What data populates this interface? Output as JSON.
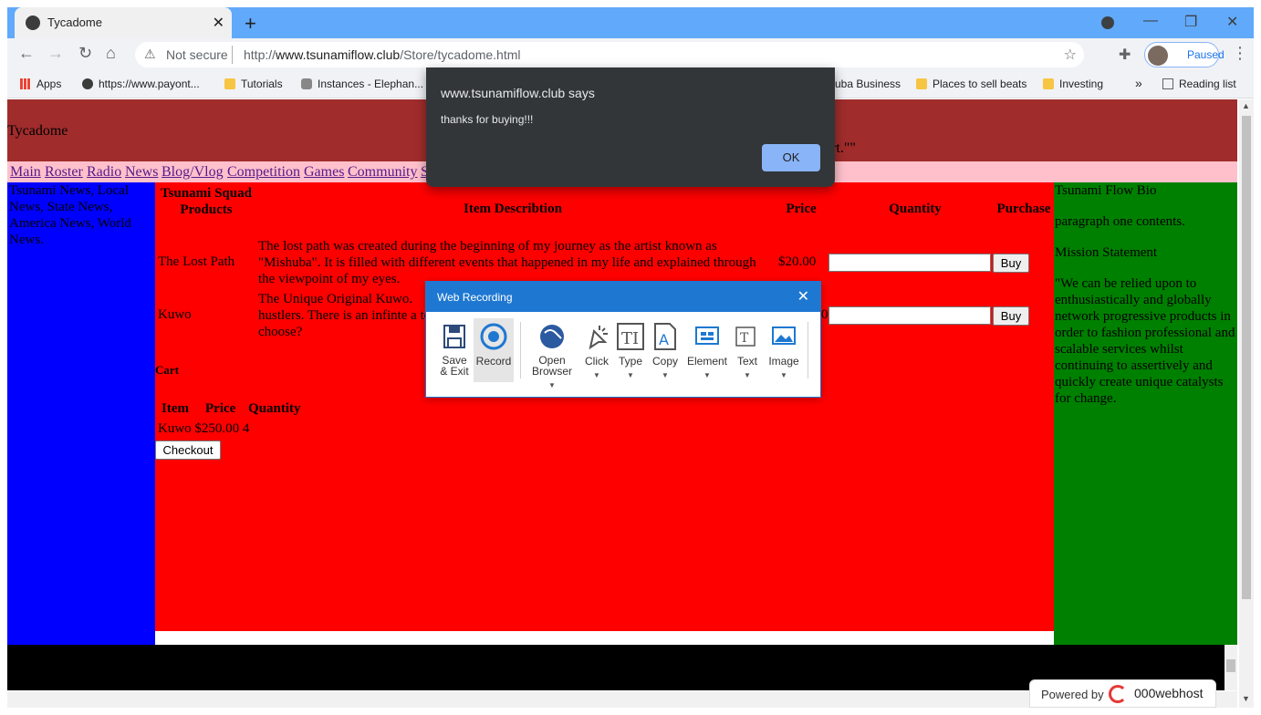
{
  "browser": {
    "tab_title": "Tycadome",
    "tab_close": "✕",
    "new_tab": "+",
    "security": "Not secure",
    "url_prefix": "http://",
    "url_domain": "www.tsunamiflow.club",
    "url_path": "/Store/tycadome.html",
    "profile_label": "Paused",
    "bookmarks": [
      {
        "label": "Apps",
        "icon": "apps-grid-icon"
      },
      {
        "label": "https://www.payont...",
        "icon": "globe-icon"
      },
      {
        "label": "Tutorials",
        "icon": "folder-icon"
      },
      {
        "label": "Instances - Elephan...",
        "icon": "elephant-icon"
      },
      {
        "label": "uba Business",
        "icon": "none"
      },
      {
        "label": "Places to sell beats",
        "icon": "folder-icon"
      },
      {
        "label": "Investing",
        "icon": "folder-icon"
      },
      {
        "label": "»",
        "icon": "none"
      },
      {
        "label": "Reading list",
        "icon": "reading-list-icon"
      }
    ]
  },
  "page": {
    "site_title": "Tycadome",
    "header_tail": "art.\"\"",
    "nav": [
      "Main",
      "Roster",
      "Radio",
      "News",
      "Blog/Vlog",
      "Competition",
      "Games",
      "Community",
      "S"
    ],
    "left_text": "Tsunami News, Local News, State News, America News, World News.",
    "table": {
      "headers": [
        "Tsunami Squad Products",
        "Item Describtion",
        "Price",
        "Quantity",
        "Purchase"
      ],
      "rows": [
        {
          "name": "The Lost Path",
          "desc": "The lost path was created during the beginning of my journey as the artist known as \"Mishuba\". It is filled with different events that happened in my life and explained through the viewpoint of my eyes.",
          "price": "$20.00",
          "buy": "Buy"
        },
        {
          "name": "Kuwo",
          "desc": "The Unique Original Kuwo. hustlers. There is an infinte a to choose?",
          "price": "0",
          "buy": "Buy"
        }
      ]
    },
    "cart": {
      "title": "Cart",
      "headers": [
        "Item",
        "Price",
        "Quantity"
      ],
      "row": "Kuwo $250.00 4",
      "checkout": "Checkout"
    },
    "right": {
      "bio_title": "Tsunami Flow Bio",
      "paragraph": "paragraph one contents.",
      "mission_title": "Mission Statement",
      "mission_text": "\"We can be relied upon to enthusiastically and globally network progressive products in order to fashion professional and scalable services whilst continuing to assertively and quickly create unique catalysts for change."
    },
    "powered_by": "Powered by",
    "powered_brand": "000webhost"
  },
  "alert": {
    "origin": "www.tsunamiflow.club says",
    "message": "thanks for buying!!!",
    "ok": "OK"
  },
  "recorder": {
    "title": "Web Recording",
    "buttons": [
      {
        "label": "Save & Exit",
        "icon": "save-icon"
      },
      {
        "label": "Record",
        "icon": "record-icon"
      },
      {
        "label": "Open Browser",
        "icon": "globe-icon"
      },
      {
        "label": "Click",
        "icon": "click-icon"
      },
      {
        "label": "Type",
        "icon": "type-icon"
      },
      {
        "label": "Copy",
        "icon": "copy-icon"
      },
      {
        "label": "Element",
        "icon": "element-icon"
      },
      {
        "label": "Text",
        "icon": "text-icon"
      },
      {
        "label": "Image",
        "icon": "image-icon"
      }
    ]
  },
  "colors": {
    "tabbar": "#61a9fb",
    "header": "#a02c2c",
    "nav": "#ffc0cb",
    "left": "#0000ff",
    "center": "#ff0000",
    "right": "#008000",
    "recorder_accent": "#1e78d2"
  }
}
